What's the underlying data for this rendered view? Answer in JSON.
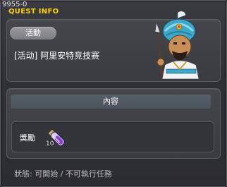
{
  "window": {
    "quest_id": "9955-0",
    "title": "QUEST INFO"
  },
  "quest": {
    "type_label": "活動",
    "name": "[活动] 阿里安特竞技赛",
    "npc_icon": "turbaned-warrior-npc"
  },
  "content": {
    "section_label": "內容",
    "reward_label": "獎勵",
    "reward_item_icon": "purple-potion-icon",
    "reward_count": "10"
  },
  "status": {
    "text": "狀態: 可開始 / 不可執行任務"
  },
  "colors": {
    "title": "#ffd400",
    "section_bar": "#4f5962",
    "pill": "#8c8c92"
  }
}
